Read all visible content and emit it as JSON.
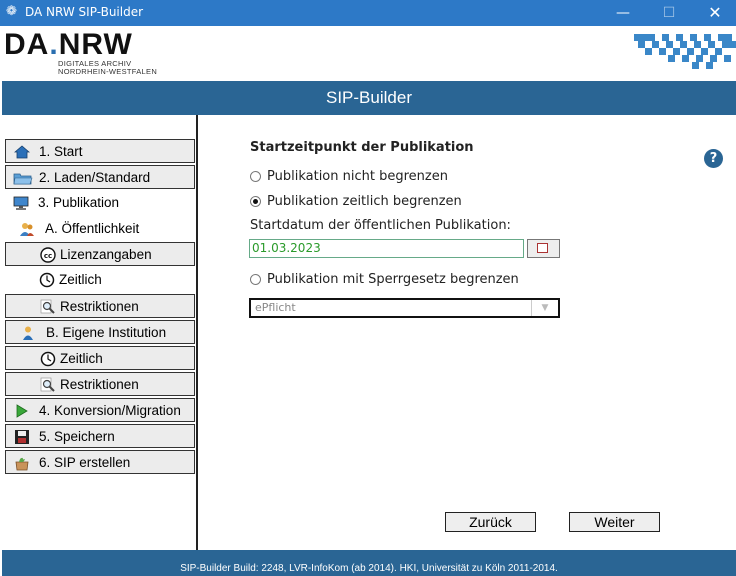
{
  "window": {
    "title": "DA NRW SIP-Builder",
    "icon": "app-icon",
    "minimize": "—",
    "maximize": "☐",
    "close": "✕"
  },
  "logo": {
    "brand_part1": "DA",
    "brand_dot": ".",
    "brand_part2": "NRW",
    "line1": "DIGITALES ARCHIV",
    "line2": "NORDRHEIN-WESTFALEN"
  },
  "header": {
    "title": "SIP-Builder"
  },
  "nav": {
    "start": "1. Start",
    "laden": "2. Laden/Standard",
    "publikation": "3. Publikation",
    "oeffentlichkeit": "A. Öffentlichkeit",
    "lizenzangaben": "Lizenzangaben",
    "zeitlich_a": "Zeitlich",
    "restriktionen_a": "Restriktionen",
    "eigene": "B. Eigene Institution",
    "zeitlich_b": "Zeitlich",
    "restriktionen_b": "Restriktionen",
    "konversion": "4. Konversion/Migration",
    "speichern": "5. Speichern",
    "sip": "6. SIP erstellen"
  },
  "main": {
    "section_title": "Startzeitpunkt der Publikation",
    "help": "?",
    "option_unlimited": "Publikation nicht begrenzen",
    "option_time_limited": "Publikation zeitlich begrenzen",
    "start_date_label": "Startdatum der öffentlichen Publikation:",
    "start_date_value": "01.03.2023",
    "option_law": "Publikation mit Sperrgesetz begrenzen",
    "law_select_value": "ePflicht",
    "selected_option": "Publikation zeitlich begrenzen"
  },
  "buttons": {
    "back": "Zurück",
    "next": "Weiter"
  },
  "footer": {
    "text": "SIP-Builder Build: 2248, LVR-InfoKom (ab 2014). HKI, Universität zu Köln 2011-2014."
  },
  "colors": {
    "titlebar": "#2d79c7",
    "header": "#2a6594",
    "footer": "#2a6594",
    "date_text": "#2a9a2a"
  }
}
